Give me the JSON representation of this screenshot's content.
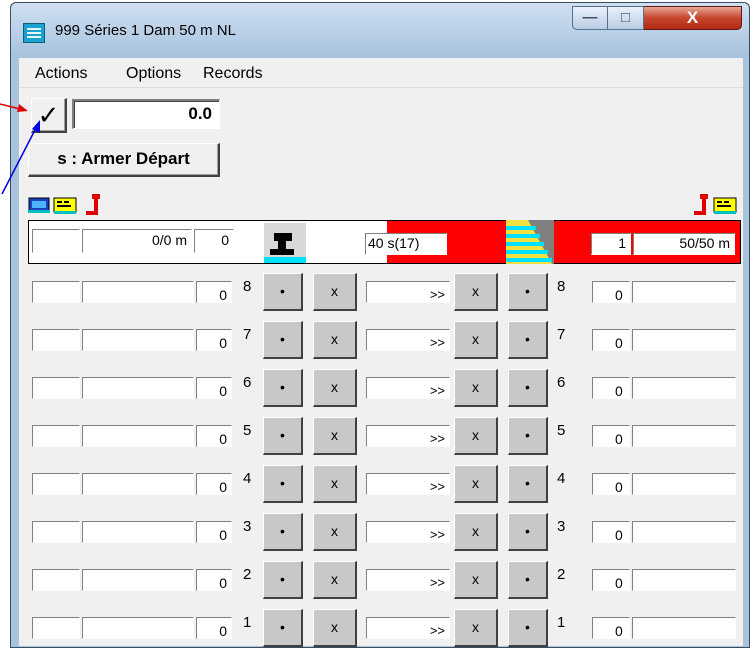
{
  "window": {
    "title": "999 Séries 1  Dam 50 m NL",
    "minimize_glyph": "—",
    "maximize_glyph": "□",
    "close_glyph": "X"
  },
  "menu": {
    "actions": "Actions",
    "options": "Options",
    "records": "Records"
  },
  "controls": {
    "check_glyph": "✓",
    "time_display": "0.0",
    "arm_button": "s : Armer Départ"
  },
  "header": {
    "left_small": "",
    "left_distance": "0/0  m",
    "left_count": "0",
    "timer": "40 s(17)",
    "right_count": "1",
    "right_distance": "50/50  m"
  },
  "lanes": [
    {
      "left_count": "0",
      "lane_left": "8",
      "dot": "•",
      "cross": "x",
      "arrow": ">>",
      "lane_right": "8",
      "right_count": "0"
    },
    {
      "left_count": "0",
      "lane_left": "7",
      "dot": "•",
      "cross": "x",
      "arrow": ">>",
      "lane_right": "7",
      "right_count": "0"
    },
    {
      "left_count": "0",
      "lane_left": "6",
      "dot": "•",
      "cross": "x",
      "arrow": ">>",
      "lane_right": "6",
      "right_count": "0"
    },
    {
      "left_count": "0",
      "lane_left": "5",
      "dot": "•",
      "cross": "x",
      "arrow": ">>",
      "lane_right": "5",
      "right_count": "0"
    },
    {
      "left_count": "0",
      "lane_left": "4",
      "dot": "•",
      "cross": "x",
      "arrow": ">>",
      "lane_right": "4",
      "right_count": "0"
    },
    {
      "left_count": "0",
      "lane_left": "3",
      "dot": "•",
      "cross": "x",
      "arrow": ">>",
      "lane_right": "3",
      "right_count": "0"
    },
    {
      "left_count": "0",
      "lane_left": "2",
      "dot": "•",
      "cross": "x",
      "arrow": ">>",
      "lane_right": "2",
      "right_count": "0"
    },
    {
      "left_count": "0",
      "lane_left": "1",
      "dot": "•",
      "cross": "x",
      "arrow": ">>",
      "lane_right": "1",
      "right_count": "0"
    }
  ],
  "colors": {
    "header_red": "#ff0000",
    "titlebar": "#a7c2de",
    "close_button": "#c5452d",
    "annotation_red": "#e00000",
    "annotation_blue": "#0000e0"
  },
  "icons": {
    "app": "app-icon",
    "computer": "computer-icon",
    "swimmer": "swimmer-flag-icon",
    "start_block": "start-block-icon",
    "pool_stairs": "pool-lanes-icon"
  }
}
